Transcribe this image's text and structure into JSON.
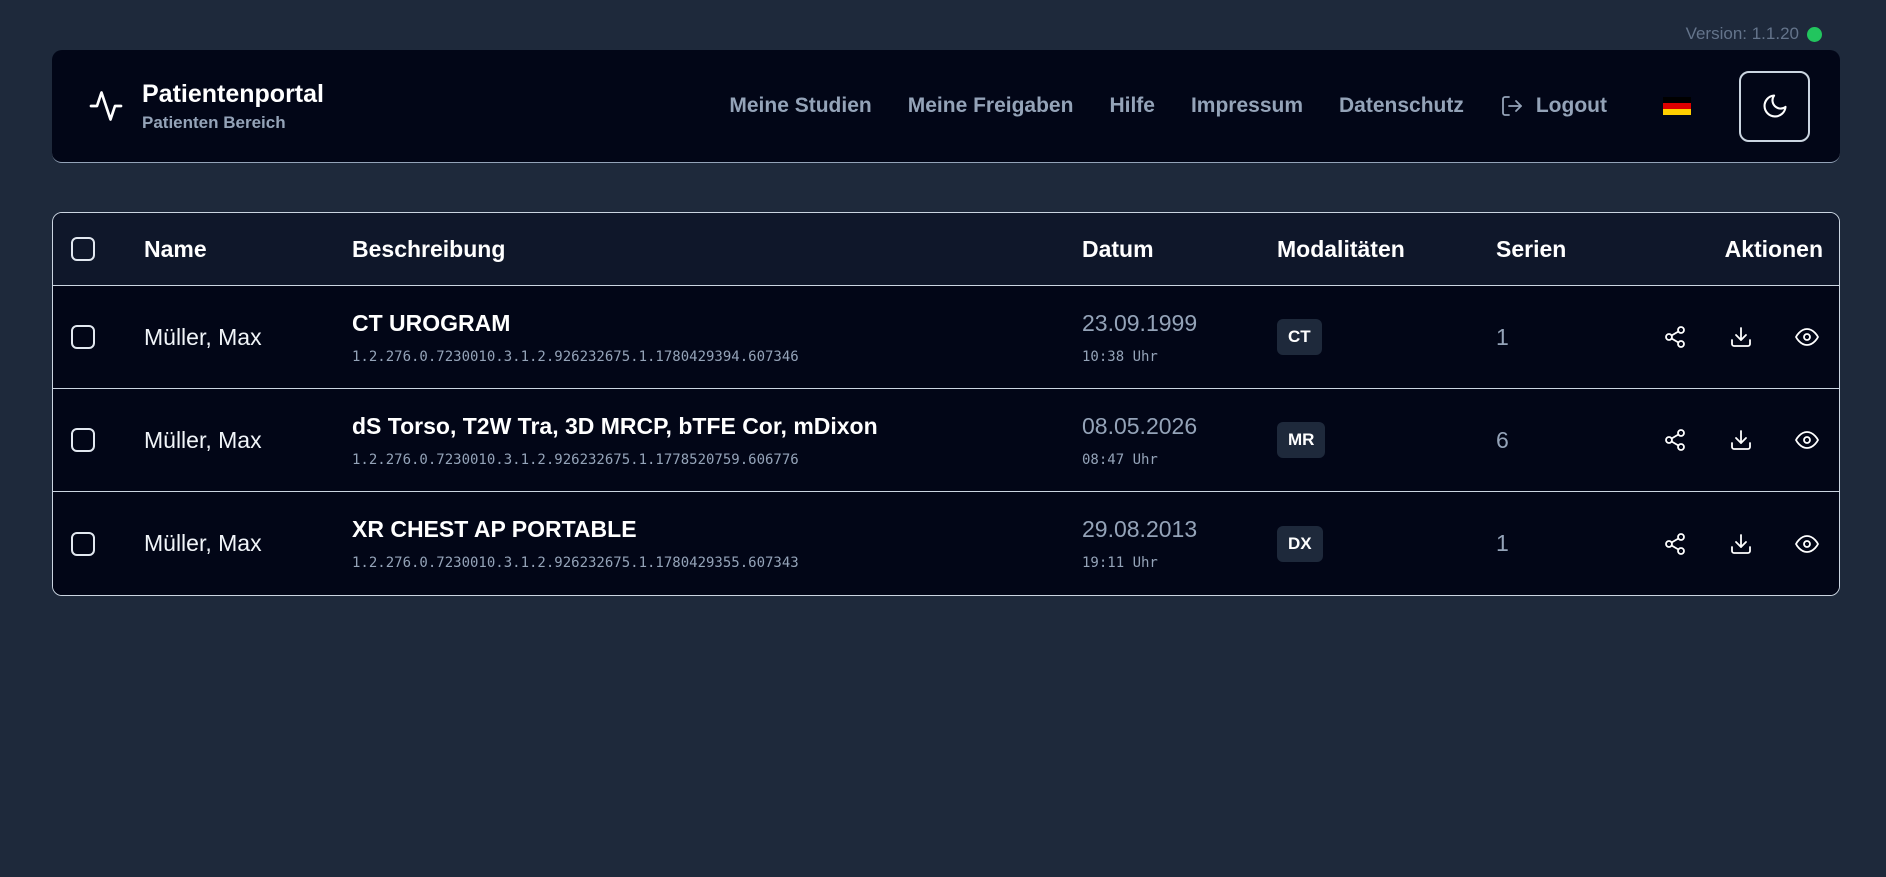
{
  "version": {
    "label": "Version: 1.1.20",
    "status_color": "#22c55e"
  },
  "header": {
    "title": "Patientenportal",
    "subtitle": "Patienten Bereich",
    "nav": [
      {
        "label": "Meine Studien"
      },
      {
        "label": "Meine Freigaben"
      },
      {
        "label": "Hilfe"
      },
      {
        "label": "Impressum"
      },
      {
        "label": "Datenschutz"
      },
      {
        "label": "Logout",
        "icon": "logout-icon"
      }
    ],
    "language_icon": "flag-de-icon",
    "theme_icon": "moon-icon"
  },
  "table": {
    "columns": [
      "Name",
      "Beschreibung",
      "Datum",
      "Modalitäten",
      "Serien",
      "Aktionen"
    ],
    "rows": [
      {
        "name": "Müller, Max",
        "description": "CT UROGRAM",
        "uid": "1.2.276.0.7230010.3.1.2.926232675.1.1780429394.607346",
        "date": "23.09.1999",
        "time": "10:38 Uhr",
        "modality": "CT",
        "series": "1"
      },
      {
        "name": "Müller, Max",
        "description": "dS Torso, T2W Tra, 3D MRCP, bTFE Cor, mDixon",
        "uid": "1.2.276.0.7230010.3.1.2.926232675.1.1778520759.606776",
        "date": "08.05.2026",
        "time": "08:47 Uhr",
        "modality": "MR",
        "series": "6"
      },
      {
        "name": "Müller, Max",
        "description": "XR CHEST AP PORTABLE",
        "uid": "1.2.276.0.7230010.3.1.2.926232675.1.1780429355.607343",
        "date": "29.08.2013",
        "time": "19:11 Uhr",
        "modality": "DX",
        "series": "1"
      }
    ],
    "action_icons": [
      "share-icon",
      "download-icon",
      "eye-icon"
    ]
  }
}
